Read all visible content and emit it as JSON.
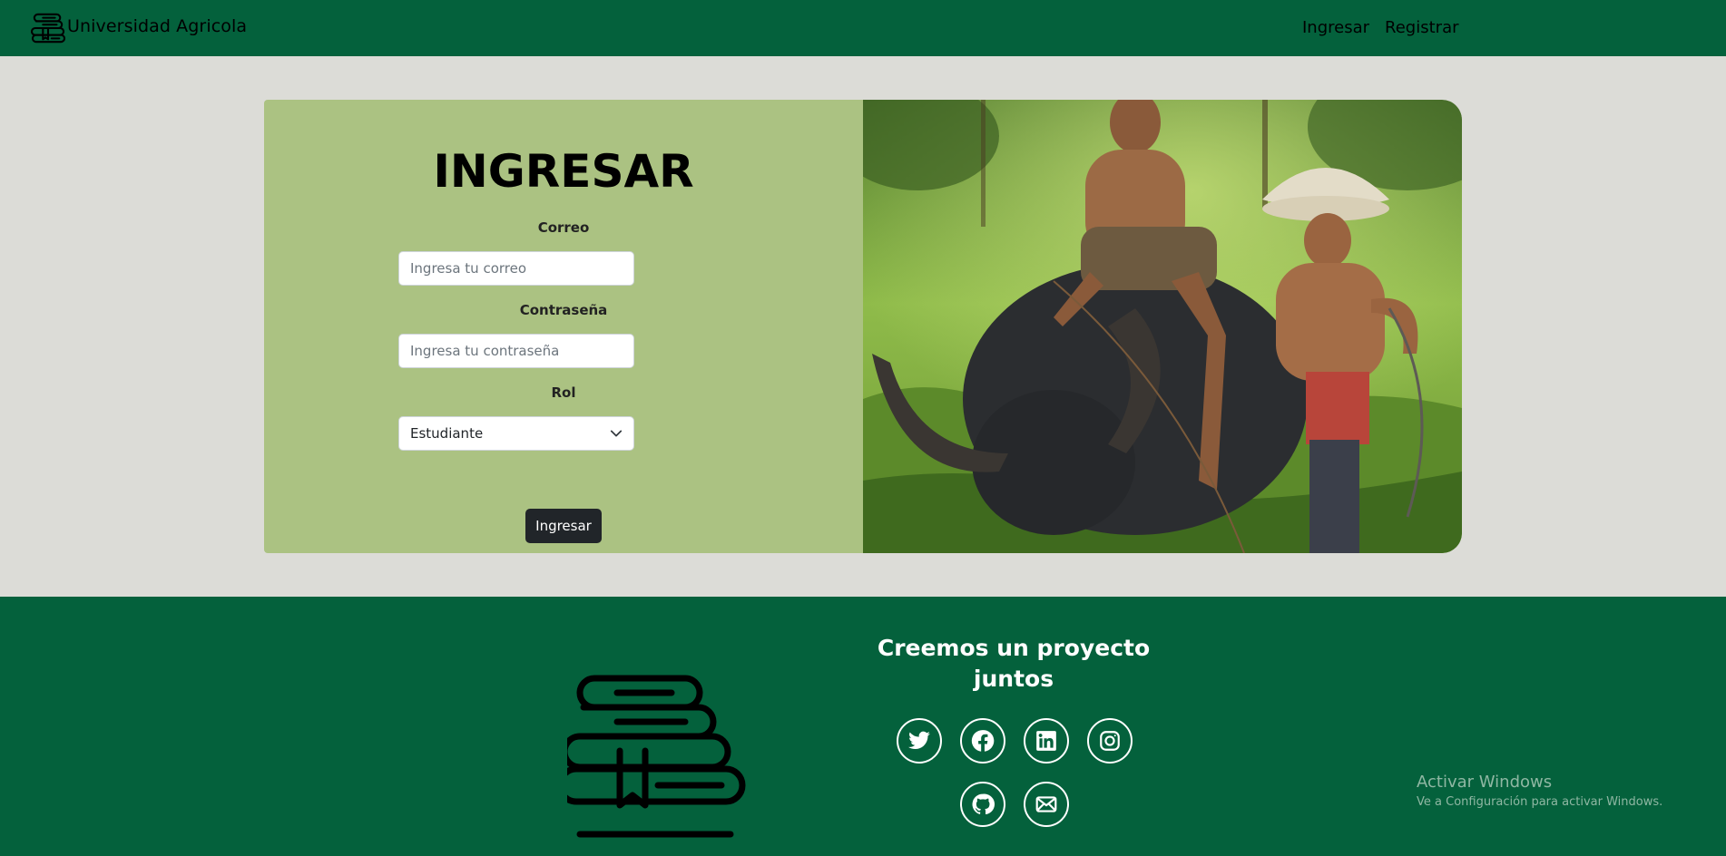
{
  "navbar": {
    "brand_text": "Universidad Agricola",
    "links": [
      "Ingresar",
      "Registrar"
    ]
  },
  "login_form": {
    "title": "INGRESAR",
    "email_label": "Correo",
    "email_placeholder": "Ingresa tu correo",
    "email_value": "",
    "password_label": "Contraseña",
    "password_placeholder": "Ingresa tu contraseña",
    "password_value": "",
    "role_label": "Rol",
    "role_selected": "Estudiante",
    "submit_label": "Ingresar"
  },
  "footer": {
    "title": "Creemos un proyecto juntos",
    "social_icons": [
      "twitter-icon",
      "facebook-icon",
      "linkedin-icon",
      "instagram-icon",
      "github-icon",
      "mail-icon"
    ]
  },
  "watermark": {
    "title": "Activar Windows",
    "subtitle": "Ve a Configuración para activar Windows."
  },
  "colors": {
    "primary_green": "#04613c",
    "form_green": "#abc282",
    "page_background": "#dcdcd7",
    "button_dark": "#212529"
  }
}
